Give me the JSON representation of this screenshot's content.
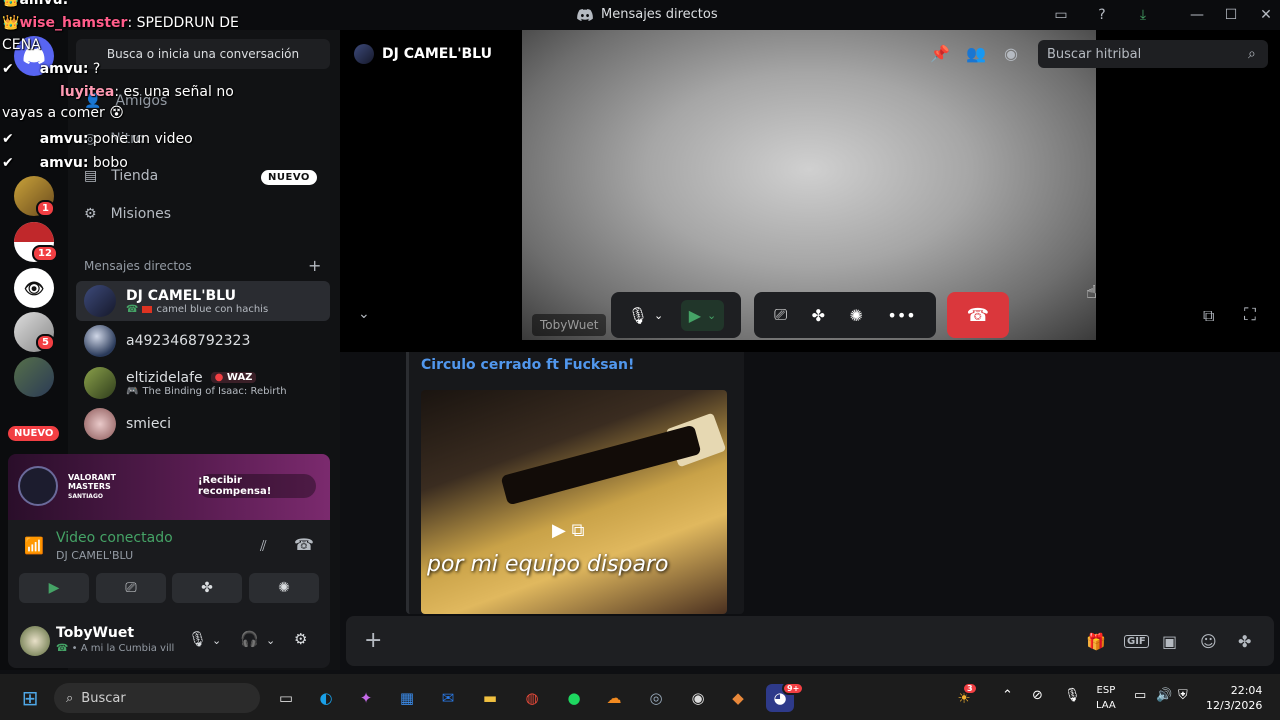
{
  "window": {
    "title": "Mensajes directos"
  },
  "chat_overlay": [
    {
      "user": "amvu:",
      "text": ""
    },
    {
      "user": "wise_hamster",
      "text": ": SPEDDRUN DE"
    },
    {
      "user": "",
      "text": "CENA"
    },
    {
      "user": "amvu:",
      "text": " ?"
    },
    {
      "user": "luyitea",
      "text": ": es una señal no"
    },
    {
      "user": "",
      "text": "vayas a comer"
    },
    {
      "user": "amvu:",
      "text": " pone un video"
    },
    {
      "user": "amvu:",
      "text": " bobo"
    }
  ],
  "rail": {
    "badges": [
      "1",
      "12",
      "5"
    ],
    "nuevo": "NUEVO"
  },
  "sidebar": {
    "search_placeholder": "Busca o inicia una conversación",
    "nav": [
      {
        "label": "Amigos",
        "icon": "friends-icon"
      },
      {
        "label": "Nitro",
        "icon": "nitro-icon"
      },
      {
        "label": "Tienda",
        "icon": "shop-icon",
        "badge": "NUEVO"
      },
      {
        "label": "Misiones",
        "icon": "quests-icon"
      }
    ],
    "dm_header": "Mensajes directos",
    "dms": [
      {
        "name": "DJ CAMEL'BLU",
        "sub": "camel blue con hachis",
        "active": true
      },
      {
        "name": "a4923468792323",
        "sub": ""
      },
      {
        "name": "eltizidelafe",
        "tag": "WAZ",
        "sub": "The Binding of Isaac: Rebirth"
      },
      {
        "name": "smieci",
        "sub": ""
      }
    ]
  },
  "promo": {
    "title": "VALORANT MASTERS",
    "location": "SANTIAGO",
    "button": "¡Recibir recompensa!"
  },
  "voice": {
    "status": "Video conectado",
    "channel": "DJ CAMEL'BLU"
  },
  "user": {
    "name": "TobyWuet",
    "status": "A mi la Cumbia vill"
  },
  "call": {
    "header_name": "DJ CAMEL'BLU",
    "search_placeholder": "Buscar hitribal",
    "video_label": "TobyWuet"
  },
  "embed": {
    "title": "Circulo cerrado ft Fucksan!",
    "caption": "por mi equipo disparo"
  },
  "taskbar": {
    "search": "Buscar",
    "lang_top": "ESP",
    "lang_bottom": "LAA",
    "time": "22:04",
    "date": "12/3/2026",
    "notif_badge": "3",
    "discord_badge": "9+"
  }
}
